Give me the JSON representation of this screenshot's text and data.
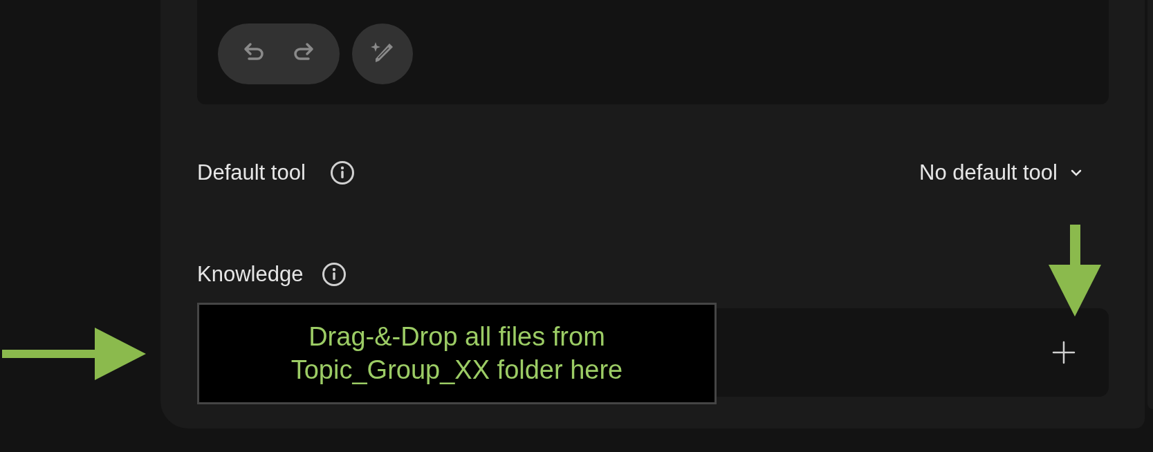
{
  "default_tool": {
    "label": "Default tool",
    "value": "No default tool"
  },
  "knowledge": {
    "label": "Knowledge"
  },
  "annotation": {
    "text": "Drag-&-Drop all files from\nTopic_Group_XX folder here"
  }
}
